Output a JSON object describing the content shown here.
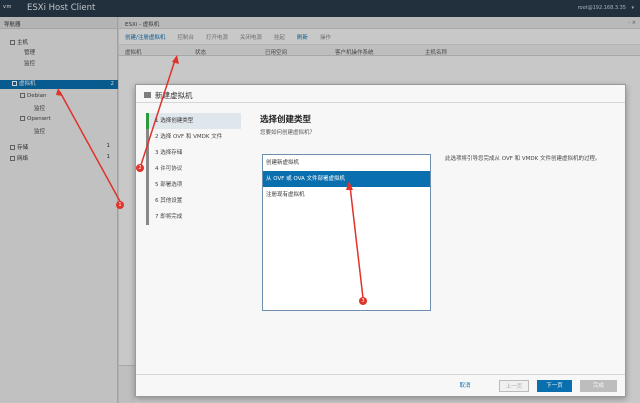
{
  "topbar": {
    "logo": "vm",
    "title": "ESXi Host Client",
    "user": "root@192.168.3.35",
    "caret": "▾"
  },
  "navigator": {
    "header": "导航器",
    "items": [
      {
        "label": "主机",
        "count": ""
      },
      {
        "label": "管理",
        "count": ""
      },
      {
        "label": "监控",
        "count": ""
      },
      {
        "label": "虚拟机",
        "count": "2"
      },
      {
        "label": "Debian",
        "count": ""
      },
      {
        "label": "监控",
        "count": ""
      },
      {
        "label": "Openwrt",
        "count": ""
      },
      {
        "label": "监控",
        "count": ""
      },
      {
        "label": "存储",
        "count": "1"
      },
      {
        "label": "网络",
        "count": "1"
      }
    ]
  },
  "main": {
    "breadcrumb": "ESXi - 虚拟机",
    "toolbar": [
      "创建/注册虚拟机",
      "控制台",
      "打开电源",
      "关闭电源",
      "挂起",
      "刷新",
      "操作"
    ],
    "columns": [
      "虚拟机",
      "状态",
      "已用空间",
      "客户机操作系统",
      "主机名称"
    ],
    "window_controls": "- ×"
  },
  "modal": {
    "title": "新建虚拟机",
    "steps": [
      "1 选择创建类型",
      "2 选择 OVF 和 VMDK 文件",
      "3 选择存储",
      "4 许可协议",
      "5 部署选项",
      "6 其他设置",
      "7 即将完成"
    ],
    "content_title": "选择创建类型",
    "content_subtitle": "您要如何创建虚拟机？",
    "options": [
      "创建新虚拟机",
      "从 OVF 或 OVA 文件部署虚拟机",
      "注册现有虚拟机"
    ],
    "description": "此选项将引导您完成从 OVF 和 VMDK 文件创建虚拟机的过程。",
    "buttons": {
      "cancel": "取消",
      "back": "上一页",
      "next": "下一页",
      "finish": "完成"
    }
  },
  "markers": [
    "1",
    "2",
    "3"
  ],
  "colors": {
    "topbar": "#2a3b4c",
    "accent": "#0a6fae",
    "marker": "#e0332a"
  }
}
